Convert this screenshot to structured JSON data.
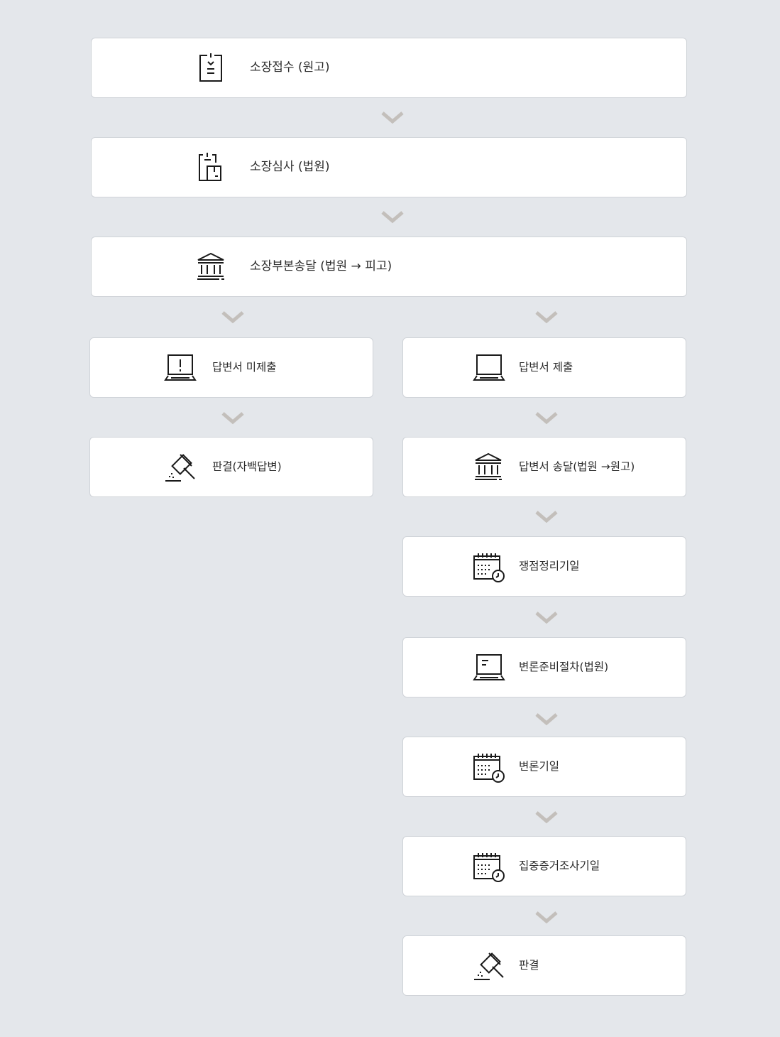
{
  "colors": {
    "background": "#e4e7eb",
    "card": "#ffffff",
    "chevron": "#c3bfbb",
    "icon": "#1a1a1a"
  },
  "steps": {
    "s1": {
      "label": "소장접수 (원고)",
      "icon": "clipboard-icon"
    },
    "s2": {
      "label": "소장심사 (법원)",
      "icon": "clipboard-review-icon"
    },
    "s3": {
      "label": "소장부본송달 (법원 → 피고)",
      "icon": "courthouse-icon"
    },
    "l1": {
      "label": "답변서 미제출",
      "icon": "laptop-alert-icon"
    },
    "l2": {
      "label": "판결(자백답변)",
      "icon": "gavel-icon"
    },
    "r1": {
      "label": "답변서 제출",
      "icon": "laptop-icon"
    },
    "r2": {
      "label": "답변서 송달(법원 →원고)",
      "icon": "courthouse-icon"
    },
    "r3": {
      "label": "쟁점정리기일",
      "icon": "calendar-clock-icon"
    },
    "r4": {
      "label": "변론준비절차(법원)",
      "icon": "laptop-document-icon"
    },
    "r5": {
      "label": "변론기일",
      "icon": "calendar-clock-icon"
    },
    "r6": {
      "label": "집중증거조사기일",
      "icon": "calendar-clock-icon"
    },
    "r7": {
      "label": "판결",
      "icon": "gavel-icon"
    }
  }
}
